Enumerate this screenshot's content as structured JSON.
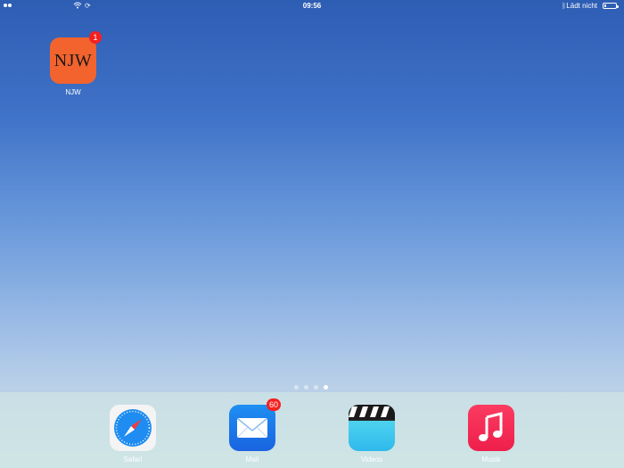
{
  "status_bar": {
    "time": "09:56",
    "charging_text": "Lädt nicht",
    "battery_level": 0.2
  },
  "home": {
    "apps": [
      {
        "label": "NJW",
        "icon_text": "NJW",
        "badge": "1",
        "icon": "njw-logo"
      }
    ]
  },
  "page_indicator": {
    "pages": 4,
    "current": 4
  },
  "dock": {
    "apps": [
      {
        "label": "Safari",
        "icon": "safari-compass-icon",
        "badge": ""
      },
      {
        "label": "Mail",
        "icon": "mail-envelope-icon",
        "badge": "60"
      },
      {
        "label": "Videos",
        "icon": "clapperboard-icon",
        "badge": ""
      },
      {
        "label": "Musik",
        "icon": "music-note-icon",
        "badge": ""
      }
    ]
  },
  "colors": {
    "badge": "#f52020",
    "njw_icon": "#f2632e",
    "wallpaper_top": "#2e5db4",
    "wallpaper_bottom": "#c7dde6"
  }
}
